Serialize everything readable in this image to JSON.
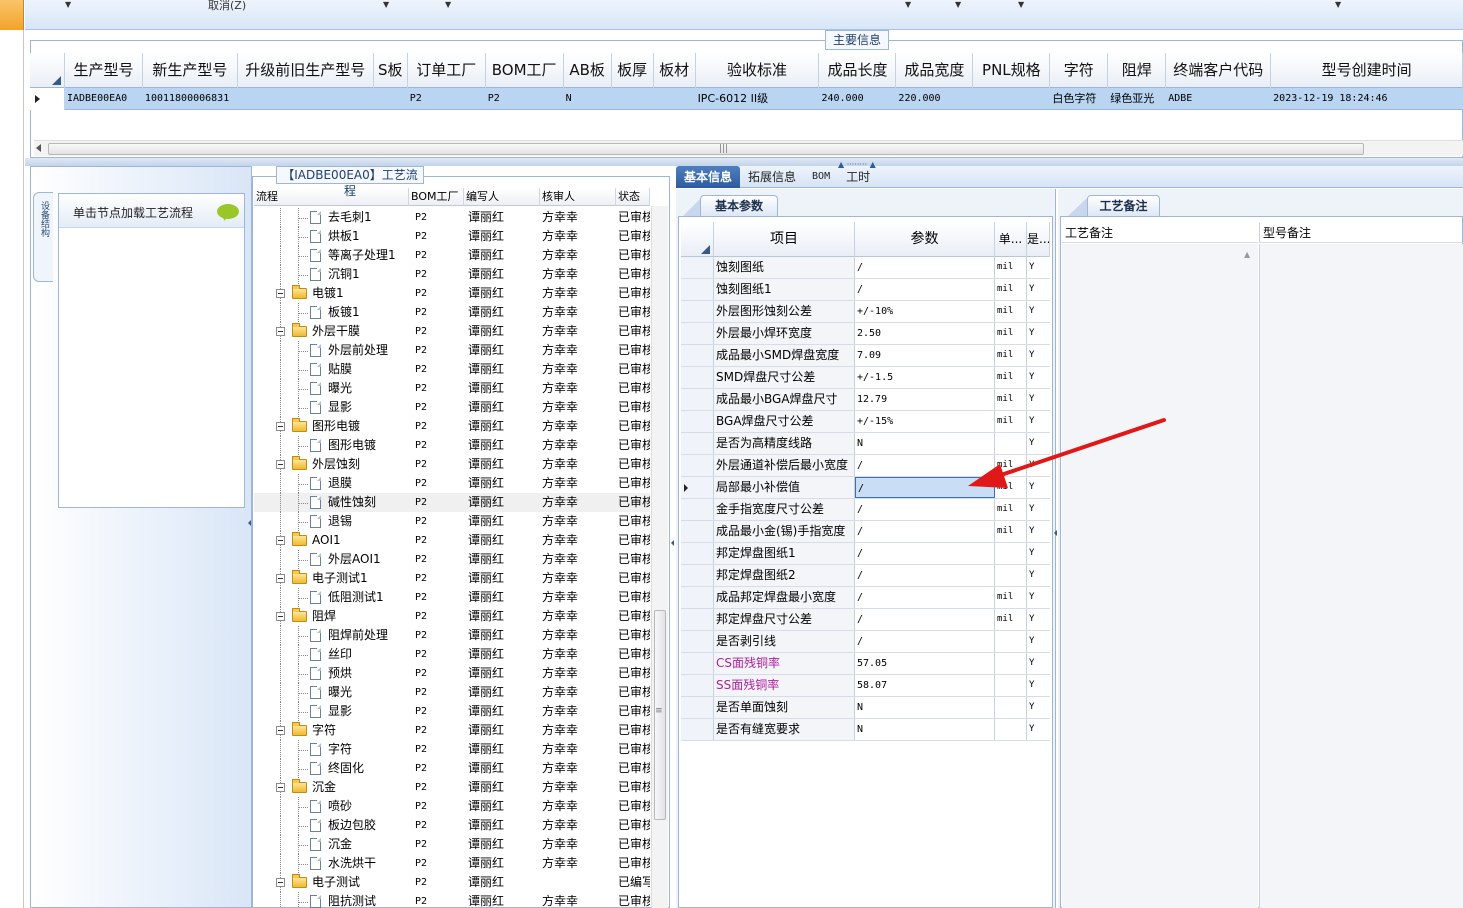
{
  "toolbar": {
    "cancel_label": "取消(Z)"
  },
  "main_info": {
    "caption": "主要信息",
    "columns": [
      {
        "label": "生产型号",
        "w": 78
      },
      {
        "label": "新生产型号",
        "w": 95
      },
      {
        "label": "升级前旧生产型号",
        "w": 136
      },
      {
        "label": "S板",
        "w": 34
      },
      {
        "label": "订单工厂",
        "w": 78
      },
      {
        "label": "BOM工厂",
        "w": 78
      },
      {
        "label": "AB板",
        "w": 48
      },
      {
        "label": "板厚",
        "w": 42
      },
      {
        "label": "板材",
        "w": 42
      },
      {
        "label": "验收标准",
        "w": 124
      },
      {
        "label": "成品长度",
        "w": 77
      },
      {
        "label": "成品宽度",
        "w": 77
      },
      {
        "label": "PNL规格",
        "w": 77
      },
      {
        "label": "字符",
        "w": 58
      },
      {
        "label": "阻焊",
        "w": 58
      },
      {
        "label": "终端客户代码",
        "w": 105
      },
      {
        "label": "型号创建时间",
        "w": 192
      }
    ],
    "row": [
      "IADBE00EA0",
      "10011800006831",
      "",
      "",
      "P2",
      "P2",
      "N",
      "",
      "",
      "IPC-6012 II级",
      "240.000",
      "220.000",
      "",
      "白色字符",
      "绿色亚光",
      "ADBE",
      "2023-12-19 18:24:46"
    ]
  },
  "left_panel": {
    "vertical_tab": "设备结构",
    "hint_text": "单击节点加载工艺流程"
  },
  "process": {
    "caption": "【IADBE00EA0】工艺流程",
    "headers": [
      "流程",
      "BOM工厂",
      "编写人",
      "核审人",
      "状态"
    ],
    "rows": [
      {
        "level": 1,
        "type": "doc",
        "name": "去毛刺1",
        "bom": "P2",
        "writer": "谭丽红",
        "reviewer": "方幸幸",
        "status": "已审核"
      },
      {
        "level": 1,
        "type": "doc",
        "name": "烘板1",
        "bom": "P2",
        "writer": "谭丽红",
        "reviewer": "方幸幸",
        "status": "已审核"
      },
      {
        "level": 1,
        "type": "doc",
        "name": "等离子处理1",
        "bom": "P2",
        "writer": "谭丽红",
        "reviewer": "方幸幸",
        "status": "已审核"
      },
      {
        "level": 1,
        "type": "doc",
        "name": "沉铜1",
        "bom": "P2",
        "writer": "谭丽红",
        "reviewer": "方幸幸",
        "status": "已审核"
      },
      {
        "level": 0,
        "type": "folder",
        "name": "电镀1",
        "bom": "P2",
        "writer": "谭丽红",
        "reviewer": "方幸幸",
        "status": "已审核"
      },
      {
        "level": 1,
        "type": "doc",
        "name": "板镀1",
        "bom": "P2",
        "writer": "谭丽红",
        "reviewer": "方幸幸",
        "status": "已审核"
      },
      {
        "level": 0,
        "type": "folder",
        "name": "外层干膜",
        "bom": "P2",
        "writer": "谭丽红",
        "reviewer": "方幸幸",
        "status": "已审核"
      },
      {
        "level": 1,
        "type": "doc",
        "name": "外层前处理",
        "bom": "P2",
        "writer": "谭丽红",
        "reviewer": "方幸幸",
        "status": "已审核"
      },
      {
        "level": 1,
        "type": "doc",
        "name": "贴膜",
        "bom": "P2",
        "writer": "谭丽红",
        "reviewer": "方幸幸",
        "status": "已审核"
      },
      {
        "level": 1,
        "type": "doc",
        "name": "曝光",
        "bom": "P2",
        "writer": "谭丽红",
        "reviewer": "方幸幸",
        "status": "已审核"
      },
      {
        "level": 1,
        "type": "doc",
        "name": "显影",
        "bom": "P2",
        "writer": "谭丽红",
        "reviewer": "方幸幸",
        "status": "已审核"
      },
      {
        "level": 0,
        "type": "folder",
        "name": "图形电镀",
        "bom": "P2",
        "writer": "谭丽红",
        "reviewer": "方幸幸",
        "status": "已审核"
      },
      {
        "level": 1,
        "type": "doc",
        "name": "图形电镀",
        "bom": "P2",
        "writer": "谭丽红",
        "reviewer": "方幸幸",
        "status": "已审核"
      },
      {
        "level": 0,
        "type": "folder",
        "name": "外层蚀刻",
        "bom": "P2",
        "writer": "谭丽红",
        "reviewer": "方幸幸",
        "status": "已审核"
      },
      {
        "level": 1,
        "type": "doc",
        "name": "退膜",
        "bom": "P2",
        "writer": "谭丽红",
        "reviewer": "方幸幸",
        "status": "已审核"
      },
      {
        "level": 1,
        "type": "doc",
        "name": "碱性蚀刻",
        "bom": "P2",
        "writer": "谭丽红",
        "reviewer": "方幸幸",
        "status": "已审核",
        "selected": true
      },
      {
        "level": 1,
        "type": "doc",
        "name": "退锡",
        "bom": "P2",
        "writer": "谭丽红",
        "reviewer": "方幸幸",
        "status": "已审核"
      },
      {
        "level": 0,
        "type": "folder",
        "name": "AOI1",
        "bom": "P2",
        "writer": "谭丽红",
        "reviewer": "方幸幸",
        "status": "已审核"
      },
      {
        "level": 1,
        "type": "doc",
        "name": "外层AOI1",
        "bom": "P2",
        "writer": "谭丽红",
        "reviewer": "方幸幸",
        "status": "已审核"
      },
      {
        "level": 0,
        "type": "folder",
        "name": "电子测试1",
        "bom": "P2",
        "writer": "谭丽红",
        "reviewer": "方幸幸",
        "status": "已审核"
      },
      {
        "level": 1,
        "type": "doc",
        "name": "低阻测试1",
        "bom": "P2",
        "writer": "谭丽红",
        "reviewer": "方幸幸",
        "status": "已审核"
      },
      {
        "level": 0,
        "type": "folder",
        "name": "阻焊",
        "bom": "P2",
        "writer": "谭丽红",
        "reviewer": "方幸幸",
        "status": "已审核"
      },
      {
        "level": 1,
        "type": "doc",
        "name": "阻焊前处理",
        "bom": "P2",
        "writer": "谭丽红",
        "reviewer": "方幸幸",
        "status": "已审核"
      },
      {
        "level": 1,
        "type": "doc",
        "name": "丝印",
        "bom": "P2",
        "writer": "谭丽红",
        "reviewer": "方幸幸",
        "status": "已审核"
      },
      {
        "level": 1,
        "type": "doc",
        "name": "预烘",
        "bom": "P2",
        "writer": "谭丽红",
        "reviewer": "方幸幸",
        "status": "已审核"
      },
      {
        "level": 1,
        "type": "doc",
        "name": "曝光",
        "bom": "P2",
        "writer": "谭丽红",
        "reviewer": "方幸幸",
        "status": "已审核"
      },
      {
        "level": 1,
        "type": "doc",
        "name": "显影",
        "bom": "P2",
        "writer": "谭丽红",
        "reviewer": "方幸幸",
        "status": "已审核"
      },
      {
        "level": 0,
        "type": "folder",
        "name": "字符",
        "bom": "P2",
        "writer": "谭丽红",
        "reviewer": "方幸幸",
        "status": "已审核"
      },
      {
        "level": 1,
        "type": "doc",
        "name": "字符",
        "bom": "P2",
        "writer": "谭丽红",
        "reviewer": "方幸幸",
        "status": "已审核"
      },
      {
        "level": 1,
        "type": "doc",
        "name": "终固化",
        "bom": "P2",
        "writer": "谭丽红",
        "reviewer": "方幸幸",
        "status": "已审核"
      },
      {
        "level": 0,
        "type": "folder",
        "name": "沉金",
        "bom": "P2",
        "writer": "谭丽红",
        "reviewer": "方幸幸",
        "status": "已审核"
      },
      {
        "level": 1,
        "type": "doc",
        "name": "喷砂",
        "bom": "P2",
        "writer": "谭丽红",
        "reviewer": "方幸幸",
        "status": "已审核"
      },
      {
        "level": 1,
        "type": "doc",
        "name": "板边包胶",
        "bom": "P2",
        "writer": "谭丽红",
        "reviewer": "方幸幸",
        "status": "已审核"
      },
      {
        "level": 1,
        "type": "doc",
        "name": "沉金",
        "bom": "P2",
        "writer": "谭丽红",
        "reviewer": "方幸幸",
        "status": "已审核"
      },
      {
        "level": 1,
        "type": "doc",
        "name": "水洗烘干",
        "bom": "P2",
        "writer": "谭丽红",
        "reviewer": "方幸幸",
        "status": "已审核"
      },
      {
        "level": 0,
        "type": "folder",
        "name": "电子测试",
        "bom": "P2",
        "writer": "谭丽红",
        "reviewer": "",
        "status": "已编写"
      },
      {
        "level": 1,
        "type": "doc",
        "name": "阻抗测试",
        "bom": "P2",
        "writer": "谭丽红",
        "reviewer": "方幸幸",
        "status": "已审核"
      }
    ]
  },
  "right_tabs": [
    "基本信息",
    "拓展信息",
    "BOM",
    "工时"
  ],
  "basic": {
    "tab": "基本参数",
    "headers": [
      "项目",
      "参数",
      "单位",
      "是否"
    ],
    "rows": [
      {
        "item": "蚀刻图纸",
        "value": "/",
        "unit": "mil",
        "yn": "Y"
      },
      {
        "item": "蚀刻图纸1",
        "value": "/",
        "unit": "mil",
        "yn": "Y"
      },
      {
        "item": "外层图形蚀刻公差",
        "value": "+/-10%",
        "unit": "mil",
        "yn": "Y"
      },
      {
        "item": "外层最小焊环宽度",
        "value": "2.50",
        "unit": "mil",
        "yn": "Y"
      },
      {
        "item": "成品最小SMD焊盘宽度",
        "value": "7.09",
        "unit": "mil",
        "yn": "Y"
      },
      {
        "item": "SMD焊盘尺寸公差",
        "value": "+/-1.5",
        "unit": "mil",
        "yn": "Y"
      },
      {
        "item": "成品最小BGA焊盘尺寸",
        "value": "12.79",
        "unit": "mil",
        "yn": "Y"
      },
      {
        "item": "BGA焊盘尺寸公差",
        "value": "+/-15%",
        "unit": "mil",
        "yn": "Y"
      },
      {
        "item": "是否为高精度线路",
        "value": "N",
        "unit": "",
        "yn": "Y"
      },
      {
        "item": "外层通道补偿后最小宽度",
        "value": "/",
        "unit": "mil",
        "yn": "Y"
      },
      {
        "item": "局部最小补偿值",
        "value": "/",
        "unit": "mil",
        "yn": "Y",
        "current": true
      },
      {
        "item": "金手指宽度尺寸公差",
        "value": "/",
        "unit": "mil",
        "yn": "Y"
      },
      {
        "item": "成品最小金(锡)手指宽度",
        "value": "/",
        "unit": "mil",
        "yn": "Y"
      },
      {
        "item": "邦定焊盘图纸1",
        "value": "/",
        "unit": "",
        "yn": "Y"
      },
      {
        "item": "邦定焊盘图纸2",
        "value": "/",
        "unit": "",
        "yn": "Y"
      },
      {
        "item": "成品邦定焊盘最小宽度",
        "value": "/",
        "unit": "mil",
        "yn": "Y"
      },
      {
        "item": "邦定焊盘尺寸公差",
        "value": "/",
        "unit": "mil",
        "yn": "Y"
      },
      {
        "item": "是否剥引线",
        "value": "/",
        "unit": "",
        "yn": "Y"
      },
      {
        "item": "CS面残铜率",
        "value": "57.05",
        "unit": "",
        "yn": "Y",
        "magenta": true
      },
      {
        "item": "SS面残铜率",
        "value": "58.07",
        "unit": "",
        "yn": "Y",
        "magenta": true
      },
      {
        "item": "是否单面蚀刻",
        "value": "N",
        "unit": "",
        "yn": "Y"
      },
      {
        "item": "是否有缝宽要求",
        "value": "N",
        "unit": "",
        "yn": "Y"
      }
    ]
  },
  "remark": {
    "tab": "工艺备注",
    "col1": "工艺备注",
    "col2": "型号备注"
  },
  "colors": {
    "accent": "#2c5c9e",
    "selection": "#bad5f2",
    "annotation_arrow": "#e01818",
    "magenta_text": "#b020a0"
  }
}
